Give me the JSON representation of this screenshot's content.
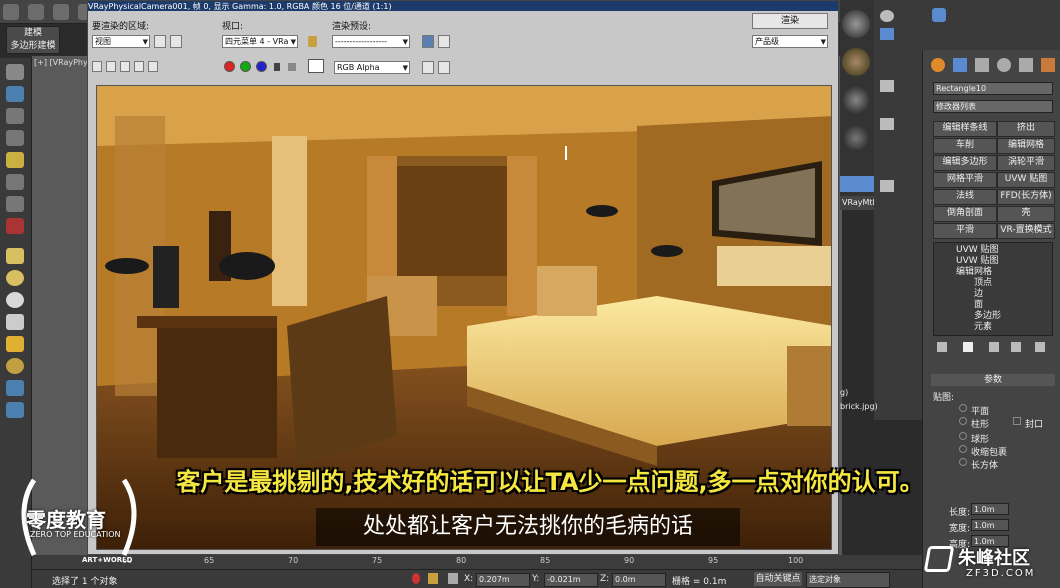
{
  "app": {
    "mode_tabs": [
      "建模",
      "多边形建模"
    ],
    "viewport_label": "[+] [VRayPhy"
  },
  "render_window": {
    "title": "VRayPhysicalCamera001, 帧 0, 显示 Gamma: 1.0, RGBA 颜色 16 位/通道 (1:1)",
    "area_label": "要渲染的区域:",
    "area_value": "视图",
    "viewport_label": "视口:",
    "viewport_value": "四元菜单 4 - VRa",
    "preset_label": "渲染预设:",
    "preset_value": "------------------",
    "render_button": "渲染",
    "quality_value": "产品级",
    "channel_value": "RGB Alpha"
  },
  "command_panel": {
    "object_name": "Rectangle10",
    "modifier_list": "修改器列表",
    "buttons": [
      "编辑样条线",
      "挤出",
      "车削",
      "编辑网格",
      "编辑多边形",
      "涡轮平滑",
      "网格平滑",
      "UVW 贴图",
      "法线",
      "FFD(长方体)",
      "倒角剖面",
      "壳",
      "平滑",
      "VR-置换模式"
    ],
    "stack": [
      "UVW 贴图",
      "UVW 贴图",
      "编辑网格",
      "顶点",
      "边",
      "面",
      "多边形",
      "元素"
    ],
    "material_label": "VRayMtl",
    "params_title": "参数",
    "mapping_label": "贴图:",
    "mapping_options": [
      "平面",
      "柱形",
      "球形",
      "收缩包裹",
      "长方体"
    ],
    "cap_label": "封口",
    "length_label": "长度:",
    "length_value": "1.0m",
    "width_label": "宽度:",
    "width_value": "1.0m",
    "height_label": "高度:",
    "height_value": "1.0m",
    "file_frag_1": "g)",
    "file_frag_2": "brick.jpg)"
  },
  "timeline": {
    "ticks": [
      "60",
      "65",
      "70",
      "75",
      "80",
      "85",
      "90",
      "95",
      "100"
    ]
  },
  "status": {
    "selected_text": "选择了 1 个对象",
    "x_label": "X:",
    "x_value": "0.207m",
    "y_label": "Y:",
    "y_value": "-0.021m",
    "z_label": "Z:",
    "z_value": "0.0m",
    "grid_text": "栅格 = 0.1m",
    "autokey": "自动关键点",
    "selected_obj": "选定对象"
  },
  "subtitles": {
    "yellow": "客户是最挑剔的,技术好的话可以让TA少一点问题,多一点对你的认可。",
    "white": "处处都让客户无法挑你的毛病的话"
  },
  "logos": {
    "left_brand": "零度教育",
    "left_sub": "ZERO TOP EDUCATION",
    "left_small": "ART+WORLD",
    "right_brand": "朱峰社区",
    "right_url": "ZF3D.COM"
  }
}
